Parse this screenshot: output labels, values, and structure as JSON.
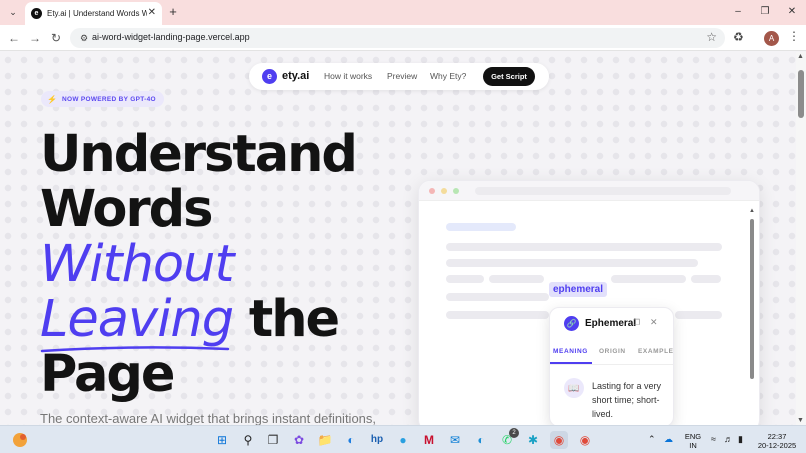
{
  "browser": {
    "tab_title": "Ety.ai | Understand Words Witho",
    "tab_favicon_letter": "e",
    "url": "ai-word-widget-landing-page.vercel.app",
    "profile_initial": "A"
  },
  "nav": {
    "brand_letter": "e",
    "brand_name": "ety.ai",
    "links": [
      "How it works",
      "Preview",
      "Why Ety?"
    ],
    "cta_label": "Get Script"
  },
  "hero": {
    "badge": "NOW POWERED BY GPT-4O",
    "line1": "Understand",
    "line2": "Words",
    "line3_accent": "Without",
    "line4_accent": "Leaving",
    "line4_rest": " the",
    "line5": "Page",
    "subtitle": "The context-aware AI widget that brings instant definitions,"
  },
  "demo": {
    "highlight_word": "ephemeral",
    "popup": {
      "word": "Ephemeral",
      "tabs": [
        "MEANING",
        "ORIGIN",
        "EXAMPLE"
      ],
      "active_tab": "MEANING",
      "definition": "Lasting for a very short time; short-lived."
    }
  },
  "taskbar": {
    "language_line1": "ENG",
    "language_line2": "IN",
    "time": "22:37",
    "date": "20-12-2025",
    "whatsapp_badge": "2"
  },
  "colors": {
    "accent": "#4f3ef0",
    "tab_strip": "#f9dede",
    "page_bg": "#f4f3f6"
  },
  "icons": [
    "tab-search-icon",
    "close-icon",
    "plus-icon",
    "minimize-icon",
    "maximize-icon",
    "back-icon",
    "forward-icon",
    "reload-icon",
    "site-info-icon",
    "star-icon",
    "extensions-icon",
    "menu-icon",
    "lightning-icon",
    "copy-icon",
    "book-icon",
    "windows-start-icon",
    "search-icon"
  ]
}
